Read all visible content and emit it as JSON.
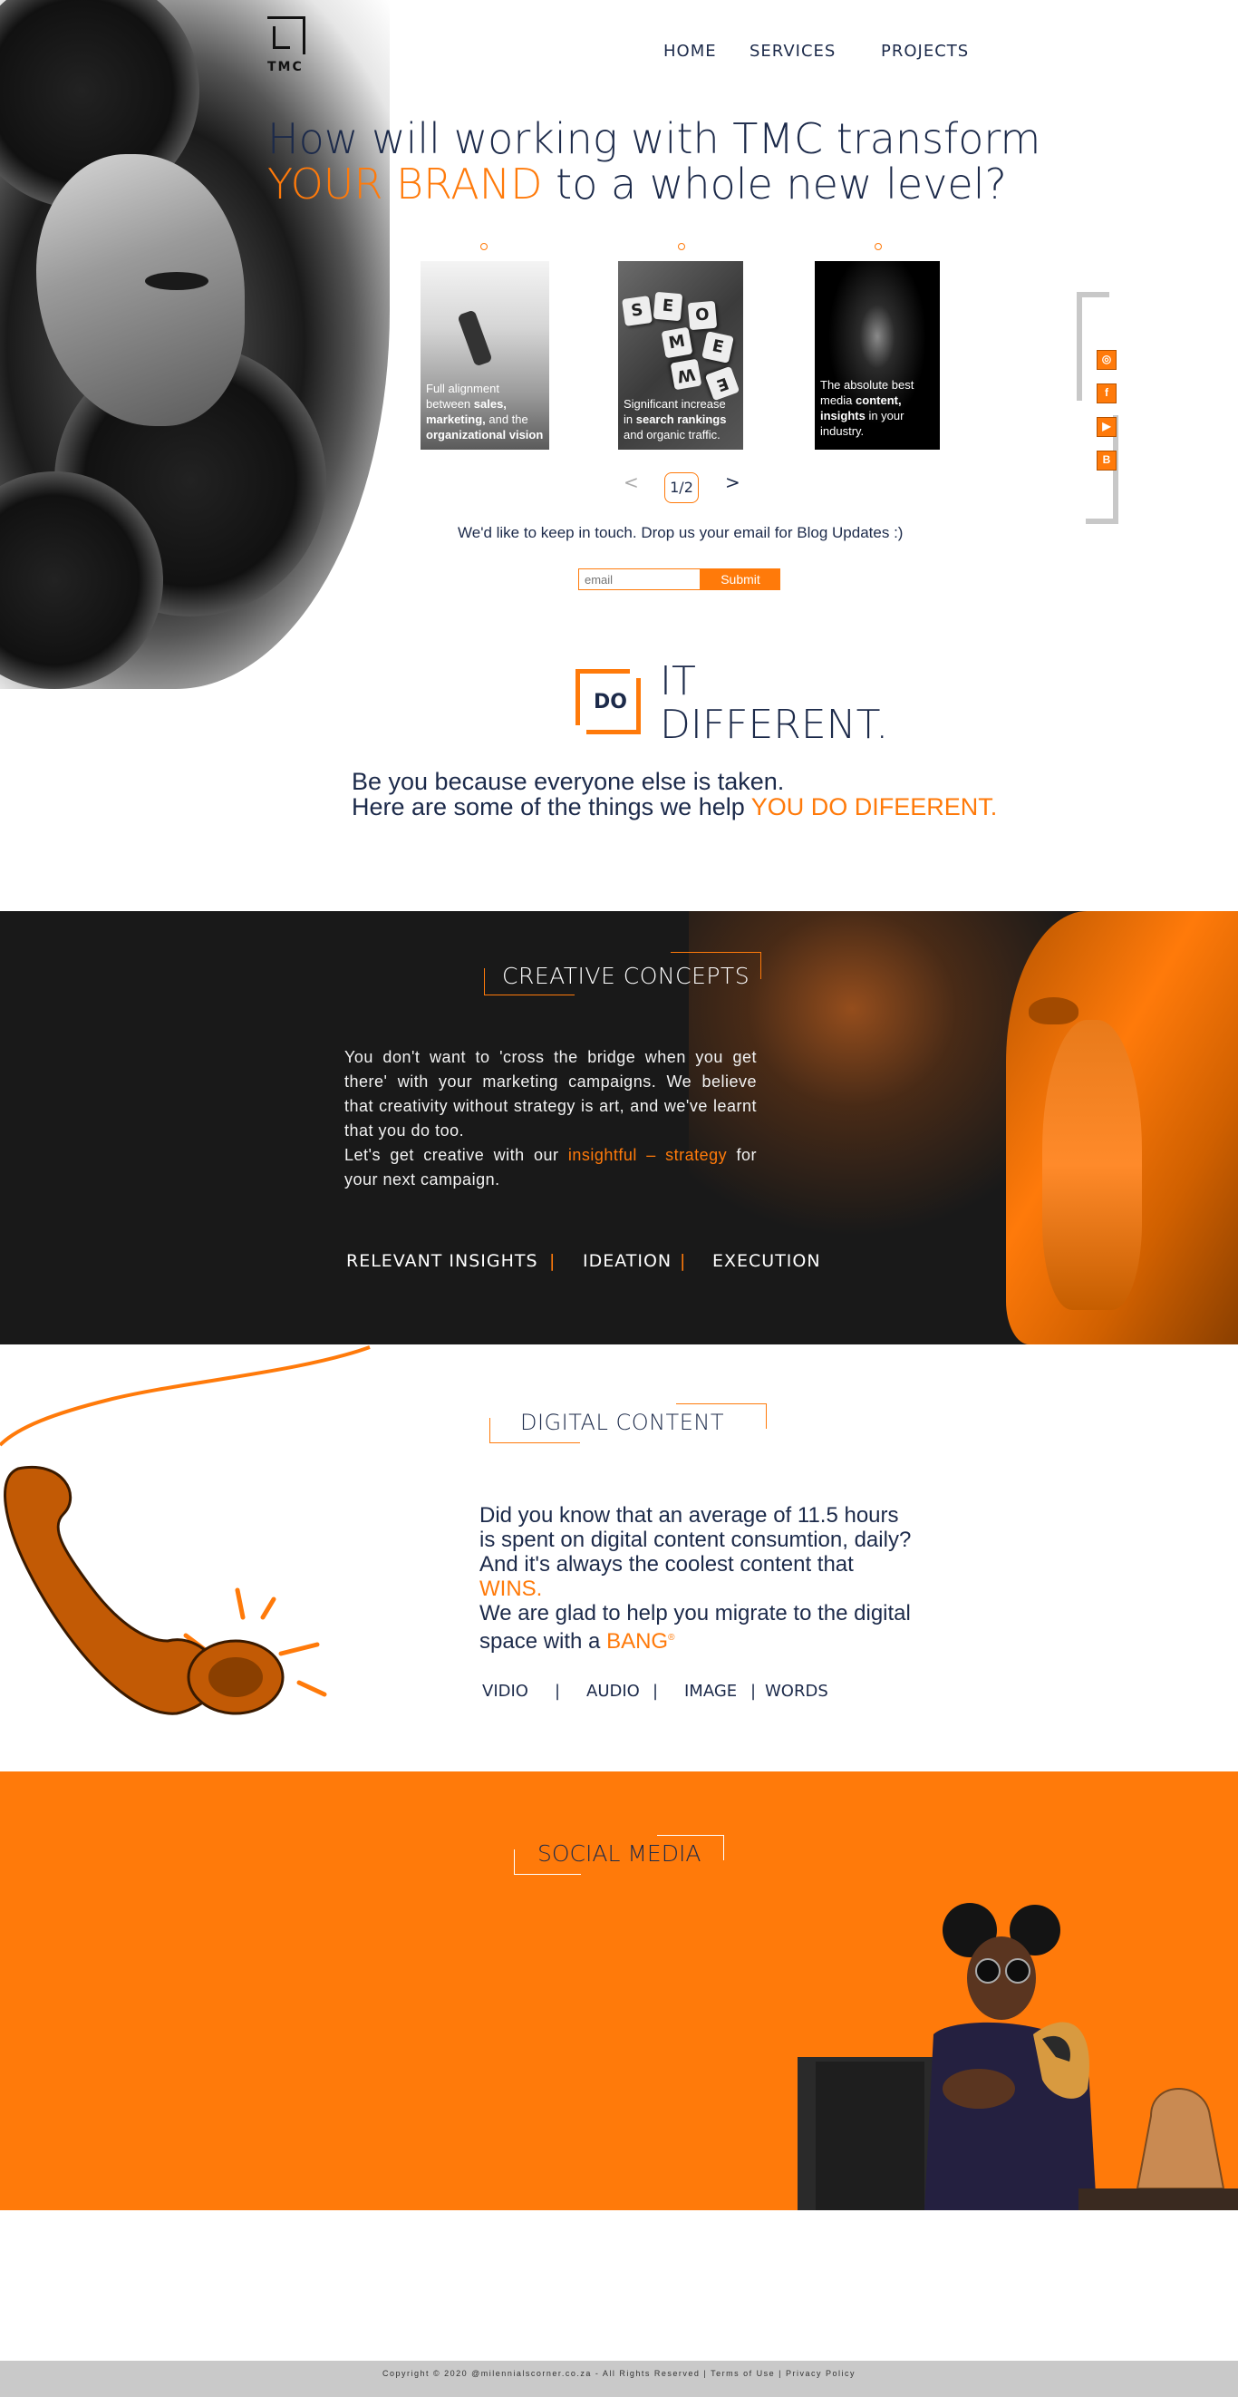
{
  "brand": {
    "logo_text": "TMC"
  },
  "nav": {
    "home": "HOME",
    "services": "SERVICES",
    "projects": "PROJECTS"
  },
  "hero": {
    "title_line1": "How will working with TMC transform",
    "title_highlight": "YOUR BRAND",
    "title_line2_rest": " to a whole new level?"
  },
  "cards": [
    {
      "text_plain1": "Full alignment between ",
      "bold1": "sales, marketing,",
      "text_plain2": " and the ",
      "bold2": "organizational vision"
    },
    {
      "text_plain1": "Significant ",
      "bold1": "increase",
      "text_plain2": " in ",
      "bold2": "search rankings",
      "text_plain3": " and organic traffic."
    },
    {
      "text_plain1": "The absolute best media ",
      "bold1": "content, insights",
      "text_plain2": " in your industry."
    }
  ],
  "pager": {
    "prev": "<",
    "current": "1/2",
    "next": ">"
  },
  "newsletter": {
    "prompt": "We'd like to keep in touch. Drop us your email for Blog Updates :)",
    "email_placeholder": "email",
    "submit_label": "Submit"
  },
  "social_icons": [
    "instagram-icon",
    "facebook-icon",
    "youtube-icon",
    "blogger-icon"
  ],
  "do_it": {
    "badge": "DO",
    "line1": "IT",
    "line2": "DIFFERENT."
  },
  "tagline": {
    "line1": "Be you because everyone else is taken.",
    "line2": "Here are some of the things we help ",
    "line2_highlight": "YOU DO DIFEERENT."
  },
  "creative": {
    "title": "CREATIVE CONCEPTS",
    "body1": "You don't want to 'cross the bridge when you get there' with your marketing campaigns. We believe that creativity without strategy is art, and we've learnt that you do too.",
    "body2_pre": "Let's get creative with our ",
    "body2_highlight": "insightful – strategy",
    "body2_post": " for your next campaign.",
    "pillars": [
      "RELEVANT  INSIGHTS",
      "IDEATION",
      "EXECUTION"
    ],
    "separator": "|"
  },
  "digital": {
    "title": "DIGITAL CONTENT",
    "body1": "Did you know that an average of 11.5 hours is spent on digital content consumtion, daily? And it's always the coolest content that ",
    "body1_highlight": "WINS.",
    "body2": "We are glad to help you migrate to the digital space with a ",
    "body2_highlight": "BANG",
    "body2_mark": "®",
    "tags": [
      "VIDIO",
      "AUDIO",
      "IMAGE",
      "WORDS"
    ],
    "separator": "|"
  },
  "social": {
    "title": "SOCIAL MEDIA"
  },
  "footer": {
    "copyright": "Copyright © 2020 @milennialscorner.co.za - All Rights Reserved",
    "terms": "Terms of Use",
    "privacy": "Privacy Policy",
    "separator": "|"
  },
  "colors": {
    "accent": "#ff7a0a",
    "navy": "#1c2a4a",
    "dark": "#191919",
    "footer_bg": "#c9c9c9"
  }
}
